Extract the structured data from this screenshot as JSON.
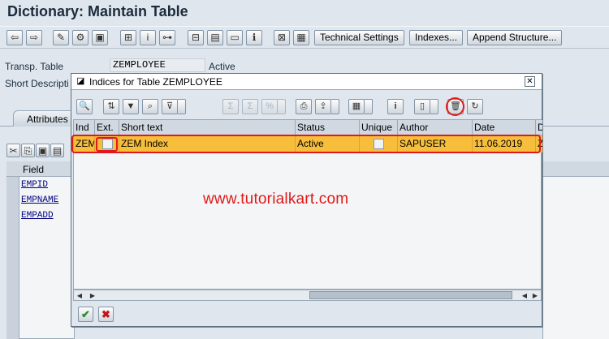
{
  "window": {
    "title": "Dictionary: Maintain Table"
  },
  "toolbar": {
    "icons": [
      "back-icon",
      "forward-icon",
      "edit-icon",
      "display-change-icon",
      "activate-icon",
      "where-used-icon",
      "check-icon",
      "hierarchy-icon",
      "table-icon",
      "contents-icon",
      "utilities-icon",
      "info-icon",
      "layout-icon",
      "object-list-icon"
    ],
    "technical_settings": "Technical Settings",
    "indexes": "Indexes...",
    "append_structure": "Append Structure..."
  },
  "form": {
    "transp_table_label": "Transp. Table",
    "transp_table_value": "ZEMPLOYEE",
    "status_value": "Active",
    "short_description_label": "Short Descripti"
  },
  "background": {
    "tab_attributes": "Attributes",
    "grid_header": "Field",
    "fields": [
      "EMPID",
      "EMPNAME",
      "EMPADD"
    ]
  },
  "dialog": {
    "title": "Indices for Table ZEMPLOYEE",
    "toolbar_icons": [
      "details-icon",
      "sort-ascending-icon",
      "filter-icon",
      "find-icon",
      "set-filter-icon",
      "total-icon",
      "subtotal-icon",
      "percent-icon",
      "print-icon",
      "export-icon",
      "layout-icon",
      "info-icon",
      "create-icon",
      "delete-icon",
      "refresh-icon"
    ],
    "columns": [
      "Ind",
      "Ext.",
      "Short text",
      "Status",
      "Unique",
      "Author",
      "Date",
      "D"
    ],
    "rows": [
      {
        "ind": "ZEM",
        "ext": false,
        "short_text": "ZEM Index",
        "status": "Active",
        "unique": false,
        "author": "SAPUSER",
        "date": "11.06.2019",
        "d": "Z"
      }
    ],
    "footer": {
      "confirm": "✔",
      "cancel": "✖"
    }
  },
  "watermark": "www.tutorialkart.com",
  "colors": {
    "selected_row": "#f7be3c",
    "highlight": "#e01a1a",
    "background": "#dfe6ee"
  }
}
